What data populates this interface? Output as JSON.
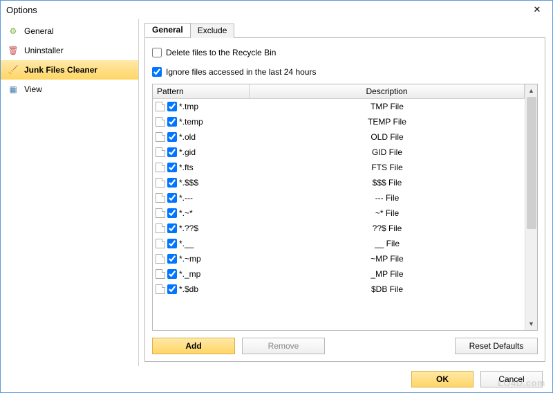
{
  "window": {
    "title": "Options"
  },
  "sidebar": {
    "items": [
      {
        "label": "General",
        "icon": "⚙",
        "icon_color": "#7cae3f"
      },
      {
        "label": "Uninstaller",
        "icon": "🗑",
        "icon_color": "#c94a4a"
      },
      {
        "label": "Junk Files Cleaner",
        "icon": "🧹",
        "icon_color": "#c9a24a",
        "selected": true
      },
      {
        "label": "View",
        "icon": "▦",
        "icon_color": "#3f7cae"
      }
    ]
  },
  "tabs": [
    {
      "label": "General",
      "active": true
    },
    {
      "label": "Exclude"
    }
  ],
  "options": {
    "delete_recycle": {
      "label": "Delete files to the Recycle Bin",
      "checked": false
    },
    "ignore_recent": {
      "label": "Ignore files accessed in the last 24 hours",
      "checked": true
    }
  },
  "columns": {
    "pattern": "Pattern",
    "description": "Description"
  },
  "rows": [
    {
      "pattern": "*.tmp",
      "description": "TMP File",
      "checked": true
    },
    {
      "pattern": "*.temp",
      "description": "TEMP File",
      "checked": true
    },
    {
      "pattern": "*.old",
      "description": "OLD File",
      "checked": true
    },
    {
      "pattern": "*.gid",
      "description": "GID File",
      "checked": true
    },
    {
      "pattern": "*.fts",
      "description": "FTS File",
      "checked": true
    },
    {
      "pattern": "*.$$$",
      "description": "$$$ File",
      "checked": true
    },
    {
      "pattern": "*.---",
      "description": "--- File",
      "checked": true
    },
    {
      "pattern": "*.~*",
      "description": "~* File",
      "checked": true
    },
    {
      "pattern": "*.??$",
      "description": "??$ File",
      "checked": true
    },
    {
      "pattern": "*.__",
      "description": "__ File",
      "checked": true
    },
    {
      "pattern": "*.~mp",
      "description": "~MP File",
      "checked": true
    },
    {
      "pattern": "*._mp",
      "description": "_MP File",
      "checked": true
    },
    {
      "pattern": "*.$db",
      "description": "$DB File",
      "checked": true
    }
  ],
  "buttons": {
    "add": "Add",
    "remove": "Remove",
    "reset": "Reset Defaults",
    "ok": "OK",
    "cancel": "Cancel"
  },
  "watermark": "LO4D.com"
}
